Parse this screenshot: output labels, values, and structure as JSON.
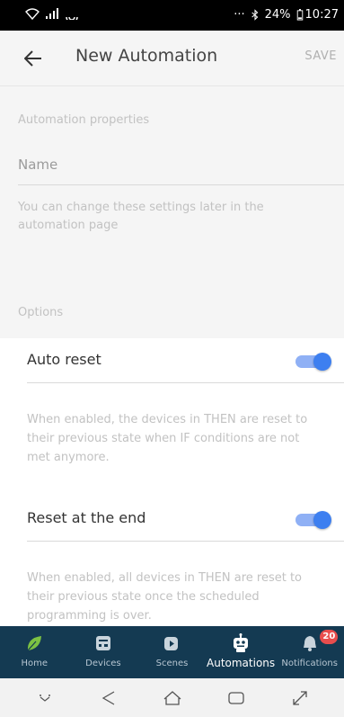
{
  "status_bar": {
    "left_icons": [
      "wifi-icon",
      "signal-icon",
      "cast-icon"
    ],
    "dots": "···",
    "battery": "24%",
    "time": "10:27"
  },
  "app_bar": {
    "title": "New Automation",
    "save_label": "SAVE",
    "back_icon": "arrow-left-icon"
  },
  "properties": {
    "section_label": "Automation properties",
    "name_placeholder": "Name",
    "name_value": "",
    "helper_text": "You can change these settings later in the automation page"
  },
  "options": {
    "section_label": "Options",
    "items": [
      {
        "label": "Auto reset",
        "enabled": true,
        "description": "When enabled, the devices in THEN are reset to their previous state when IF conditions are not met anymore."
      },
      {
        "label": "Reset at the end",
        "enabled": true,
        "description": "When enabled, all devices in THEN are reset to their previous state once the scheduled programming is over."
      }
    ]
  },
  "bottom_nav": {
    "items": [
      {
        "label": "Home",
        "icon": "leaf-icon",
        "active": false
      },
      {
        "label": "Devices",
        "icon": "device-icon",
        "active": false
      },
      {
        "label": "Scenes",
        "icon": "scene-icon",
        "active": false
      },
      {
        "label": "Automations",
        "icon": "robot-icon",
        "active": true
      },
      {
        "label": "Notifications",
        "icon": "bell-icon",
        "active": false,
        "badge": "20"
      }
    ]
  },
  "colors": {
    "nav_background": "#143a52",
    "toggle_on": "#3d7ff0",
    "badge": "#e84d4d",
    "leaf": "#7cc243"
  },
  "system_nav": [
    "chevron-down-icon",
    "back-triangle-icon",
    "home-icon",
    "recents-icon",
    "expand-icon"
  ]
}
